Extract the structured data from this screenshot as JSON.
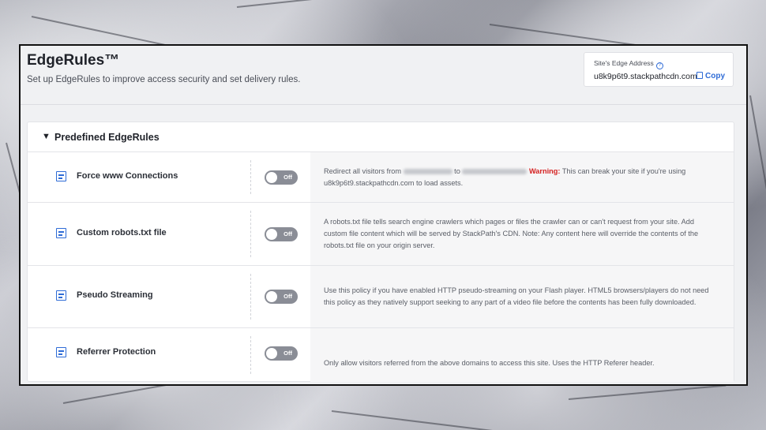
{
  "header": {
    "title": "EdgeRules™",
    "subtitle": "Set up EdgeRules to improve access security and set delivery rules."
  },
  "edge_address": {
    "label": "Site's Edge Address",
    "help_icon": "?",
    "value": "u8k9p6t9.stackpathcdn.com",
    "copy_label": "Copy"
  },
  "panel": {
    "title": "Predefined EdgeRules",
    "rules": [
      {
        "name": "Force www Connections",
        "toggle": "Off",
        "desc_prefix": "Redirect all visitors from",
        "desc_mid": "to",
        "warning": "Warning:",
        "desc_suffix": "This can break your site if you're using u8k9p6t9.stackpathcdn.com to load assets."
      },
      {
        "name": "Custom robots.txt file",
        "toggle": "Off",
        "desc": "A robots.txt file tells search engine crawlers which pages or files the crawler can or can't request from your site. Add custom file content which will be served by StackPath's CDN. Note: Any content here will override the contents of the robots.txt file on your origin server."
      },
      {
        "name": "Pseudo Streaming",
        "toggle": "Off",
        "desc": "Use this policy if you have enabled HTTP pseudo-streaming on your Flash player. HTML5 browsers/players do not need this policy as they natively support seeking to any part of a video file before the contents has been fully downloaded."
      },
      {
        "name": "Referrer Protection",
        "toggle": "Off",
        "desc": "Only allow visitors referred from the above domains to access this site. Uses the HTTP Referer header."
      }
    ]
  },
  "colors": {
    "accent": "#2e6bd6",
    "warning": "#d42020",
    "toggle_off": "#8a8d96"
  }
}
